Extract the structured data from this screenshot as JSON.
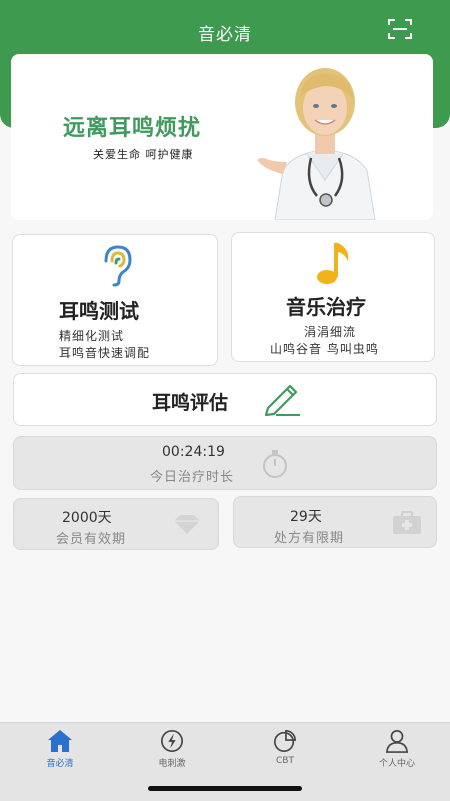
{
  "header": {
    "title": "音必清",
    "scan_icon": "scan-icon"
  },
  "banner": {
    "title": "远离耳鸣烦扰",
    "subtitle": "关爱生命  呵护健康"
  },
  "cards": {
    "tinnitus_test": {
      "title": "耳鸣测试",
      "line1": "精细化测试",
      "line2": "耳鸣音快速调配",
      "icon": "ear-icon"
    },
    "music_therapy": {
      "title": "音乐治疗",
      "line1": "涓涓细流",
      "line2": "山鸣谷音 鸟叫虫鸣",
      "icon": "music-note-icon"
    },
    "assessment": {
      "title": "耳鸣评估",
      "icon": "pencil-icon"
    }
  },
  "stats": {
    "treatment_time": {
      "value": "00:24:19",
      "label": "今日治疗时长"
    },
    "membership": {
      "value": "2000天",
      "label": "会员有效期"
    },
    "prescription": {
      "value": "29天",
      "label": "处方有限期"
    }
  },
  "tabbar": {
    "items": [
      {
        "label": "音必清",
        "icon": "home-icon",
        "active": true
      },
      {
        "label": "电刺激",
        "icon": "lightning-icon",
        "active": false
      },
      {
        "label": "CBT",
        "icon": "pie-chart-icon",
        "active": false
      },
      {
        "label": "个人中心",
        "icon": "user-icon",
        "active": false
      }
    ]
  },
  "colors": {
    "brand": "#3e9a4f",
    "active_tab": "#2b6fcf",
    "card_bg": "#ffffff",
    "stat_bg": "#e6e6e6"
  }
}
